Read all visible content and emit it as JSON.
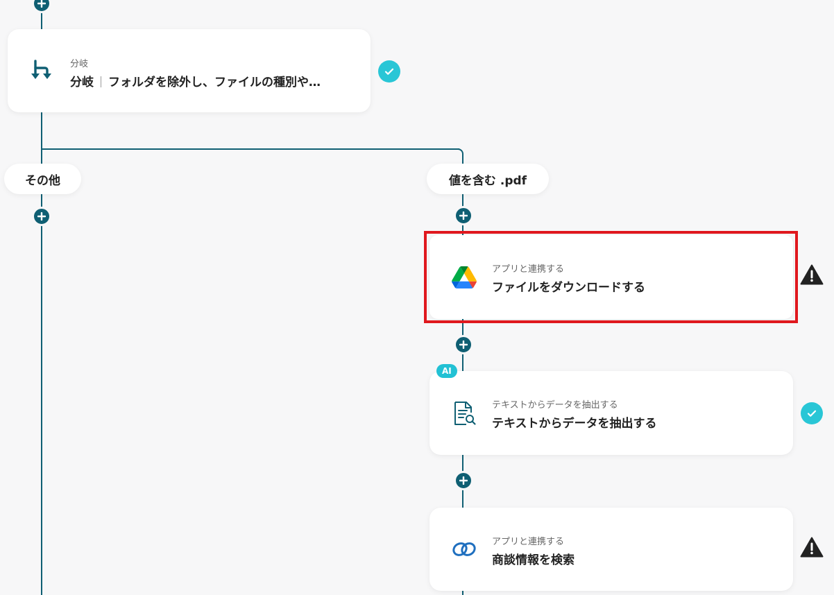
{
  "branch_card": {
    "sub": "分岐",
    "title_main": "分岐",
    "title_detail": "フォルダを除外し、ファイルの種別や…"
  },
  "branches": {
    "left_label": "その他",
    "right_label": "値を含む .pdf"
  },
  "steps": [
    {
      "sub": "アプリと連携する",
      "title": "ファイルをダウンロードする",
      "icon": "google-drive-icon",
      "status": "warning"
    },
    {
      "badge": "AI",
      "sub": "テキストからデータを抽出する",
      "title": "テキストからデータを抽出する",
      "icon": "document-search-icon",
      "status": "complete"
    },
    {
      "sub": "アプリと連携する",
      "title": "商談情報を検索",
      "icon": "zoho-crm-icon",
      "status": "warning"
    }
  ],
  "colors": {
    "flow_line": "#0f5f73",
    "check": "#29c6d6",
    "highlight": "#e0181e",
    "background": "#f7f7f8"
  }
}
